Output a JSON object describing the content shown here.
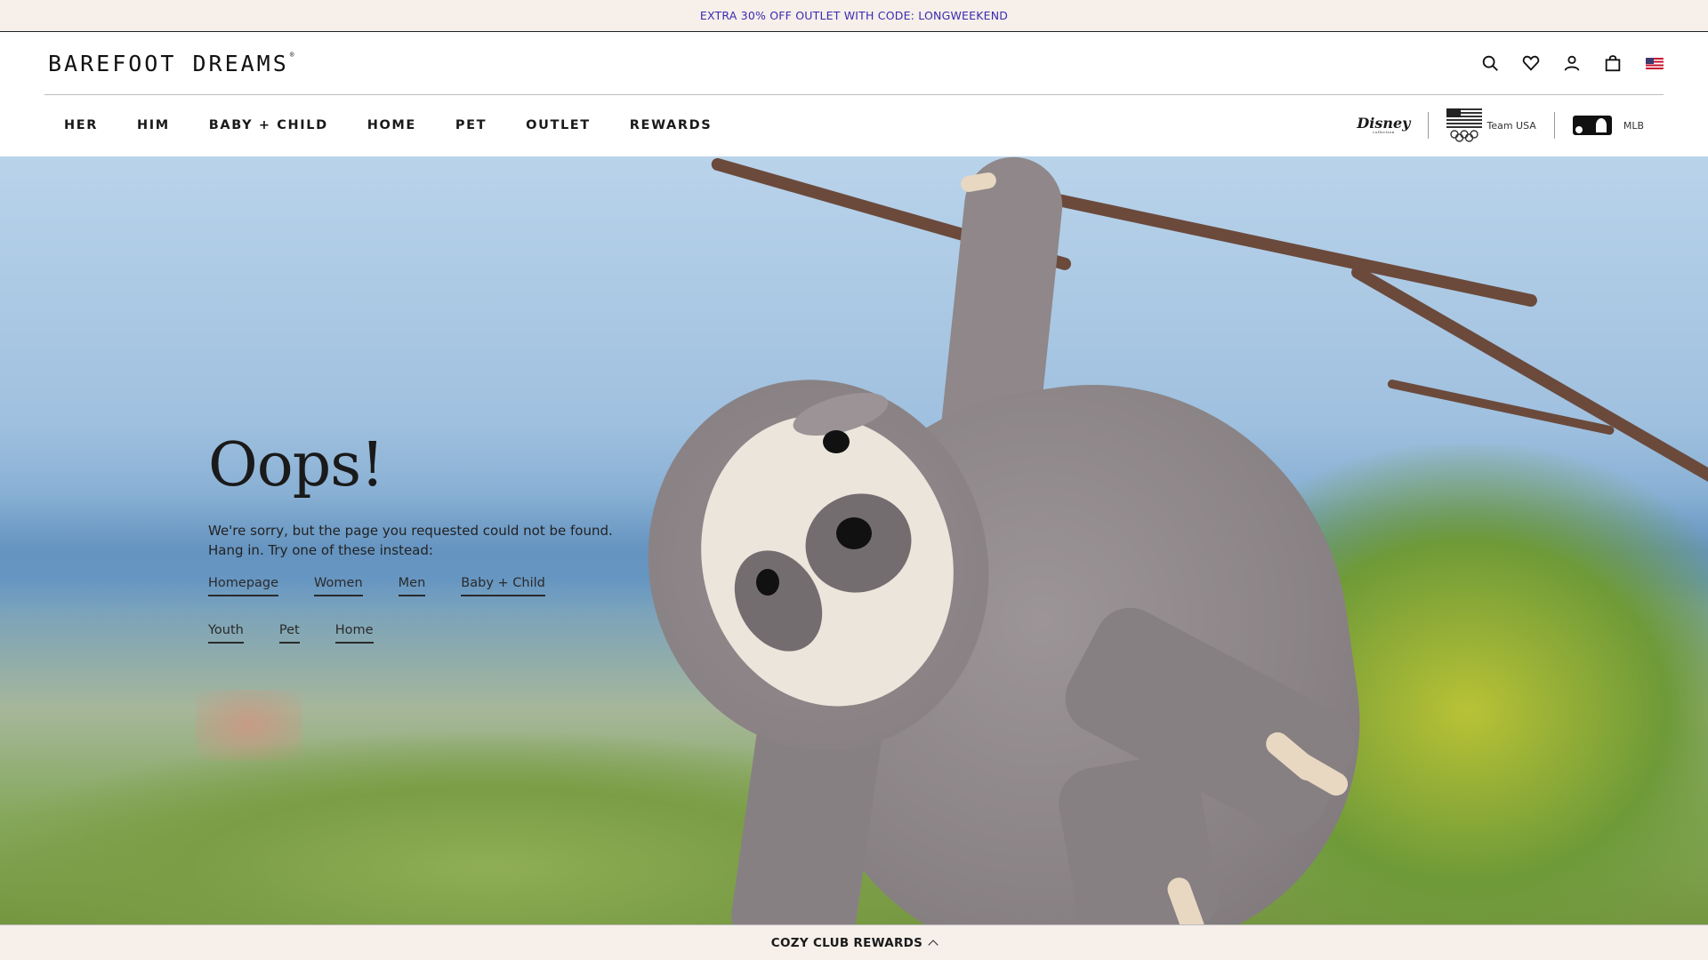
{
  "promo": {
    "text": "EXTRA 30% OFF OUTLET WITH CODE: LONGWEEKEND"
  },
  "header": {
    "logo": "BAREFOOT DREAMS",
    "logo_mark": "®",
    "icons": [
      "search-icon",
      "heart-icon",
      "account-icon",
      "bag-icon",
      "us-flag-icon"
    ]
  },
  "nav": {
    "items": [
      "HER",
      "HIM",
      "BABY + CHILD",
      "HOME",
      "PET",
      "OUTLET",
      "REWARDS"
    ]
  },
  "partners": {
    "disney": "Disney",
    "team_usa": "Team USA",
    "mlb": "MLB"
  },
  "error": {
    "title": "Oops!",
    "line1": "We're sorry, but the page you requested could not be found.",
    "line2": "Hang in. Try one of these instead:",
    "links": [
      "Homepage",
      "Women",
      "Men",
      "Baby + Child",
      "Youth",
      "Pet",
      "Home"
    ]
  },
  "rewards_bar": {
    "label": "COZY CLUB REWARDS"
  },
  "colors": {
    "promo_bg": "#f6efea",
    "promo_text": "#3b2bb0"
  }
}
